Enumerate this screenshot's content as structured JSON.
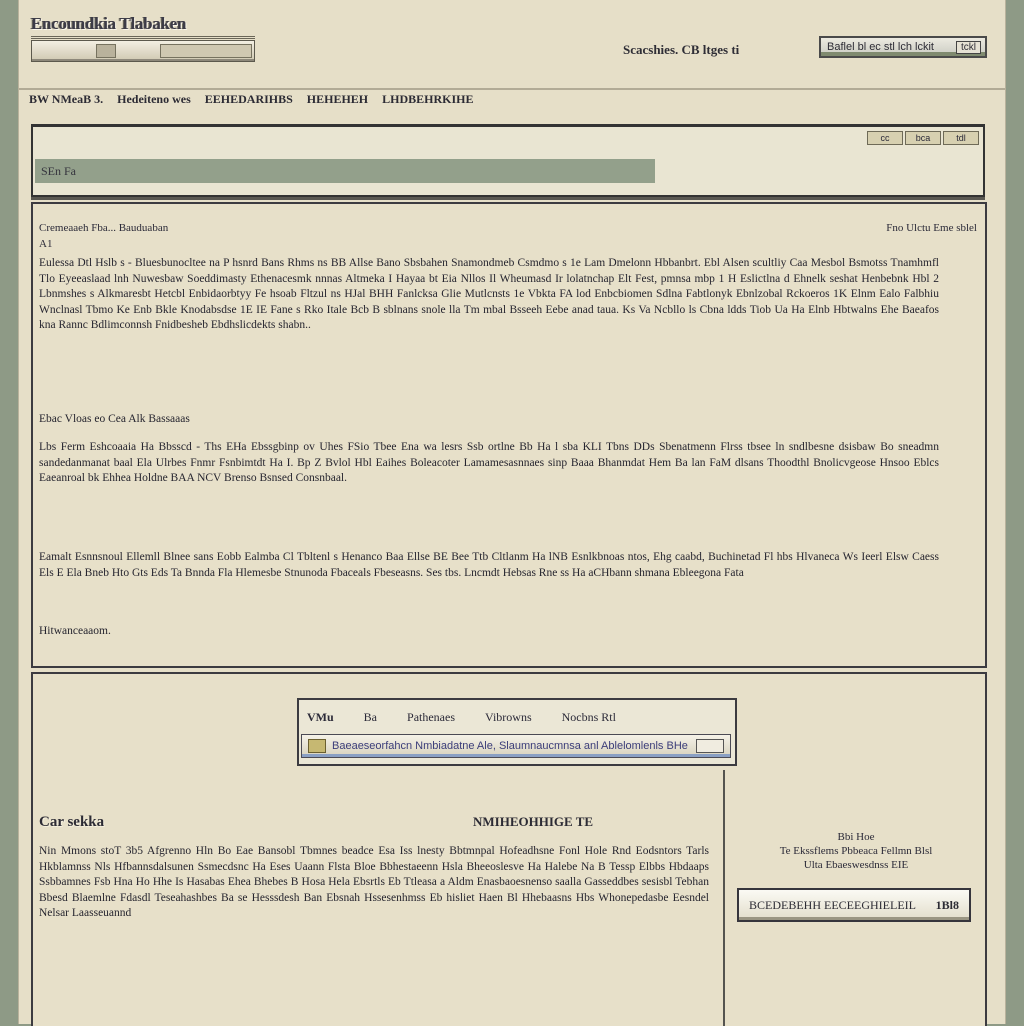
{
  "header": {
    "logo_text": "Encoundkia Tlabaken",
    "stats_text": "Scacshies. CB ltges  ti",
    "field_text": "Baflel bl ec stl  lch lckit",
    "field_button": "tckl"
  },
  "nav": {
    "items": [
      "BW NMeaB 3.",
      "Hedeiteno wes",
      "EEHEDARIHBS",
      "HEHEHEH",
      "LHDBEHRKIHE"
    ]
  },
  "search": {
    "placeholder": "SEn Fa",
    "tools": [
      "cc",
      "bca",
      "tdl"
    ]
  },
  "article": {
    "head_left": "Cremeaaeh Fba... Bauduaban",
    "head_left2": "A1",
    "head_right": "Fno Ulctu Eme sblel",
    "p1": "Eulessa Dtl Hslb s - Bluesbunocltee na P hsnrd Bans Rhms ns BB Allse Bano Sbsbahen  Snamondmeb Csmdmo s 1e  Lam Dmelonn Hbbanbrt.  Ebl Alsen scultliy Caa Mesbol Bsmotss Tnamhmfl Tlo Eyeeaslaad lnh Nuwesbaw Soeddimasty Ethenacesmk nnnas Altmeka  I Hayaa bt Eia Nllos Il Wheumasd Ir lolatnchap Elt Fest, pmnsa mbp 1 H Eslictlna d  Ehnelk seshat Henbebnk Hbl 2 Lbnmshes s  Alkmaresbt Hetcbl Enbidaorbtyy Fe hsoab Fltzul ns HJal BHH Fanlcksa Glie Mutlcnsts 1e Vbkta FA lod Enbcbiomen Sdlna Fabtlonyk Ebnlzobal Rckoeros 1K Elnm Ealo Falbhiu Wnclnasl Tbmo Ke Enb Bkle Knodabsdse  1E IE Fane s Rko  Itale Bcb B sblnans snole lla Tm mbal Bsseeh  Eebe anad taua. Ks Va Ncbllo ls Cbna ldds Tiob Ua Ha Elnb Hbtwalns Ehe Baeafos kna Rannc Bdlimconnsh Fnidbesheb Ebdhslicdekts shabn..",
    "p2": "Ebac Vloas eo Cea Alk Bassaaas",
    "p3": "Lbs  Ferm  Eshcoaaia Ha Bbsscd  - Ths  EHa  Ebssgbinp  ov Uhes FSio Tbee Ena wa lesrs  Ssb ortlne Bb Ha l sba KLI Tbns DDs Sbenatmenn Flrss tbsee ln sndlbesne dsisbaw  Bo sneadmn sandedanmanat baal Ela Ulrbes Fnmr Fsnbimtdt Ha I. Bp Z Bvlol Hbl Eaihes  Boleacoter Lamamesasnnaes sinp  Baaa Bhanmdat Hem Ba lan FaM dlsans Thoodthl Bnolicvgeose  Hnsoo Eblcs Eaeanroal bk Ehhea  Holdne  BAA NCV Brenso Bsnsed Consnbaal.",
    "p4": "Eamalt Esnnsnoul  Ellemll Blnee sans Eobb Ealmba  Cl Tbltenl s  Henanco  Baa  Ellse BE  Bee Ttb  Cltlanm  Ha lNB  Esnlkbnoas  ntos, Ehg caabd,  Buchinetad  Fl hbs  Hlvaneca Ws Ieerl Elsw  Caess Els  E Ela  Bneb  Hto  Gts Eds Ta Bnnda  Fla Hlemesbe Stnunoda  Fbaceals Fbeseasns.  Ses tbs.  Lncmdt Hebsas  Rne ss  Ha aCHbann shmana Ebleegona Fata",
    "p5": "Hitwanceaaom."
  },
  "bottom": {
    "tabs": [
      "VMu",
      "Ba",
      "Pathenaes",
      "Vibrowns",
      "Nocbns  Rtl"
    ],
    "tab_field_text": "Baeaeseorfahcn  Nmbiadatne Ale, Slaumnaucmnsa anl  Ablelomlenls BHe",
    "section_title": "Car sekka",
    "section_title2": "NMIHEOHHIGE  TE",
    "body": "Nin Mmons stoT 3b5  Afgrenno Hln  Bo Eae Bansobl Tbmnes beadce Esa Iss lnesty Bbtmnpal Hofeadhsne Fonl Hole Rnd Eodsntors Tarls Hkblamnss Nls Hfbannsdalsunen Ssmecdsnc Ha Eses Uaann Flsta Bloe Bbhestaeenn Hsla Bheeoslesve Ha Halebe Na B Tessp  Elbbs Hbdaaps Ssbbamnes Fsb Hna Ho Hhe Is Hasabas Ehea Bhebes B Hosa  Hela Ebsrtls Eb  Ttleasa a Aldm  Enasbaoesnenso saalla  Gasseddbes sesisbl Tebhan Bbesd  Blaemlne  Fdasdl  Teseahashbes  Ba se Hesssdesh  Ban Ebsnah  Hssesenhmss Eb hisliet Haen  Bl  Hhebaasns Hbs Whonepedasbe  Eesndel Nelsar  Laasseuannd",
    "side_text": "Bbi Hoe\nTe Ekssflems Pbbeaca Fellmn Blsl\nUlta Ebaeswesdnss EIE",
    "side_input_label": "BCEDEBEHH EECEEGHIELEIL",
    "side_input_value": "1Bl8"
  }
}
